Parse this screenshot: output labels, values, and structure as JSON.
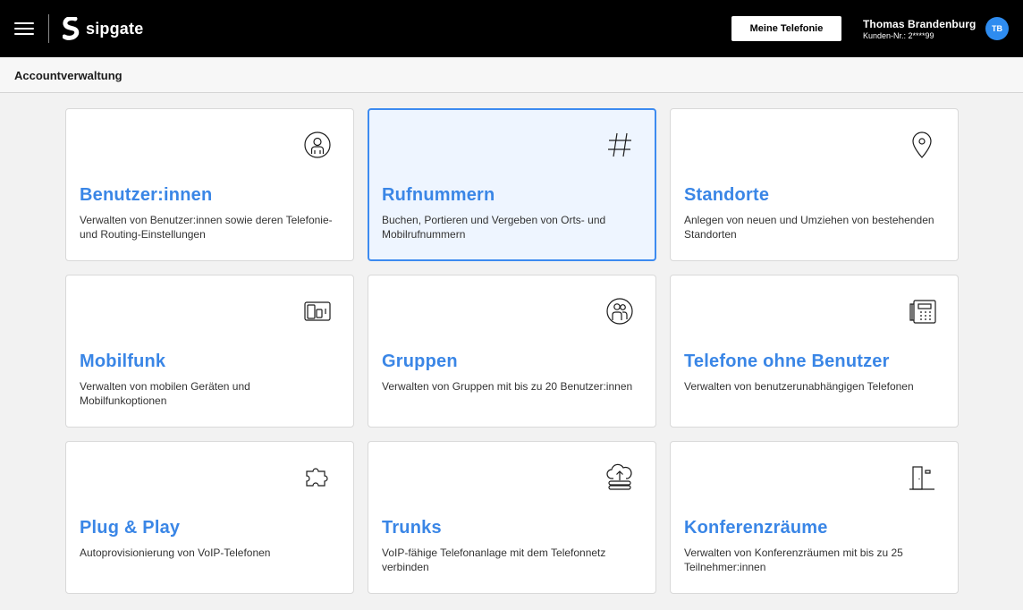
{
  "header": {
    "brand": "sipgate",
    "telephony_button": "Meine Telefonie",
    "user_name": "Thomas Brandenburg",
    "customer_number": "Kunden-Nr.: 2****99",
    "avatar_initials": "TB",
    "icons": [
      "menu-icon",
      "sipgate-logo-icon"
    ]
  },
  "subheader": {
    "title": "Accountverwaltung"
  },
  "colors": {
    "accent": "#3a86e6",
    "avatar": "#2e8cf0",
    "topbar": "#000000",
    "active_card_bg": "#eef5ff",
    "active_card_border": "#3d8bf0"
  },
  "cards": [
    {
      "title": "Benutzer:innen",
      "description": "Verwalten von Benutzer:innen sowie deren Telefonie- und Routing-Einstellungen",
      "icon": "user-icon",
      "active": false
    },
    {
      "title": "Rufnummern",
      "description": "Buchen, Portieren und Vergeben von Orts- und Mobilrufnummern",
      "icon": "hash-icon",
      "active": true
    },
    {
      "title": "Standorte",
      "description": "Anlegen von neuen und Umziehen von bestehenden Standorten",
      "icon": "location-pin-icon",
      "active": false
    },
    {
      "title": "Mobilfunk",
      "description": "Verwalten von mobilen Geräten und Mobilfunkoptionen",
      "icon": "mobile-devices-icon",
      "active": false
    },
    {
      "title": "Gruppen",
      "description": "Verwalten von Gruppen mit bis zu 20 Benutzer:innen",
      "icon": "group-icon",
      "active": false
    },
    {
      "title": "Telefone ohne Benutzer",
      "description": "Verwalten von benutzerunabhängigen Telefonen",
      "icon": "desk-phone-icon",
      "active": false
    },
    {
      "title": "Plug & Play",
      "description": "Autoprovisionierung von VoIP-Telefonen",
      "icon": "puzzle-icon",
      "active": false
    },
    {
      "title": "Trunks",
      "description": "VoIP-fähige Telefonanlage mit dem Telefonnetz verbinden",
      "icon": "cloud-upload-server-icon",
      "active": false
    },
    {
      "title": "Konferenzräume",
      "description": "Verwalten von Konferenzräumen mit bis zu 25 Teilnehmer:innen",
      "icon": "door-icon",
      "active": false
    }
  ]
}
